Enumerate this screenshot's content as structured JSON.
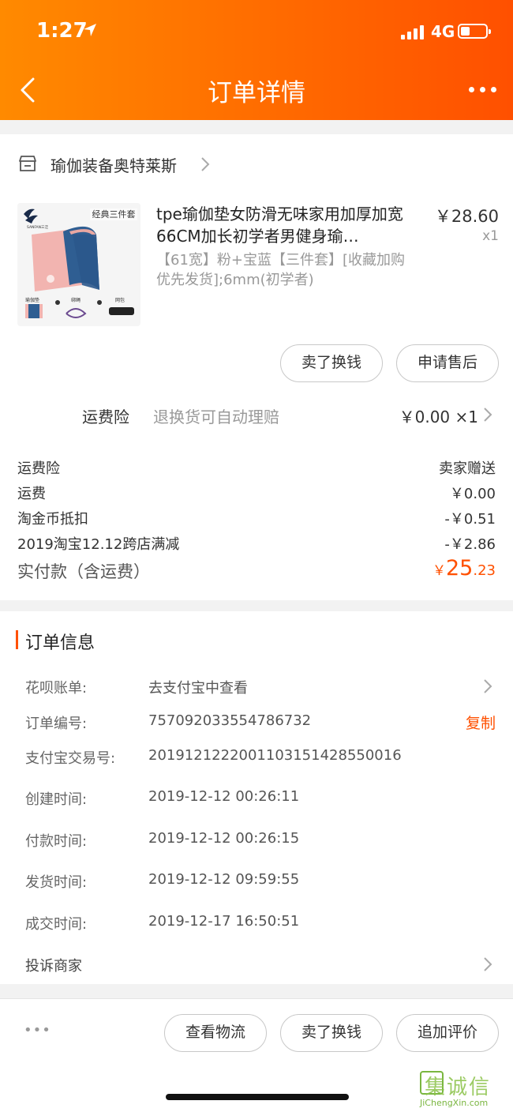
{
  "status_bar": {
    "time": "1:27",
    "network": "4G"
  },
  "header": {
    "title": "订单详情"
  },
  "shop": {
    "name": "瑜伽装备奥特莱斯"
  },
  "product": {
    "title": "tpe瑜伽垫女防滑无味家用加厚加宽66CM加长初学者男健身瑜…",
    "price": "￥28.60",
    "quantity": "x1",
    "sku": "【61宽】粉+宝蓝【三件套】[收藏加购优先发货];6mm(初学者)",
    "image_badge": "经典三件套",
    "image_brand": "SANFAN三泛",
    "image_parts": [
      "瑜伽垫",
      "+",
      "绑绳",
      "+",
      "网包"
    ],
    "buttons": {
      "sell": "卖了换钱",
      "after_sale": "申请售后"
    }
  },
  "insurance": {
    "label": "运费险",
    "desc": "退换货可自动理赔",
    "value": "￥0.00 ×1"
  },
  "price_rows": [
    {
      "label": "运费险",
      "value": "卖家赠送"
    },
    {
      "label": "运费",
      "value": "￥0.00"
    },
    {
      "label": "淘金币抵扣",
      "value": "-￥0.51"
    },
    {
      "label": "2019淘宝12.12跨店满减",
      "value": "-￥2.86"
    }
  ],
  "total": {
    "label": "实付款（含运费）",
    "currency": "￥",
    "integer": "25",
    "decimal": ".23"
  },
  "order_info": {
    "section_title": "订单信息",
    "rows": [
      {
        "label": "花呗账单:",
        "value": "去支付宝中查看"
      },
      {
        "label": "订单编号:",
        "value": "757092033554786732",
        "action": "复制"
      },
      {
        "label": "支付宝交易号:",
        "value": "2019121222001103151428550016"
      },
      {
        "label": "创建时间:",
        "value": "2019-12-12 00:26:11"
      },
      {
        "label": "付款时间:",
        "value": "2019-12-12 00:26:15"
      },
      {
        "label": "发货时间:",
        "value": "2019-12-12 09:59:55"
      },
      {
        "label": "成交时间:",
        "value": "2019-12-17 16:50:51"
      }
    ],
    "complaint": "投诉商家"
  },
  "bottom_bar": {
    "more": "•••",
    "logistics": "查看物流",
    "sell": "卖了换钱",
    "review": "追加评价"
  },
  "watermark": {
    "text": "集诚信",
    "url": "JiChengXin.com"
  },
  "colors": {
    "accent": "#ff5000",
    "header_start": "#ff8a00",
    "header_end": "#ff5000"
  }
}
